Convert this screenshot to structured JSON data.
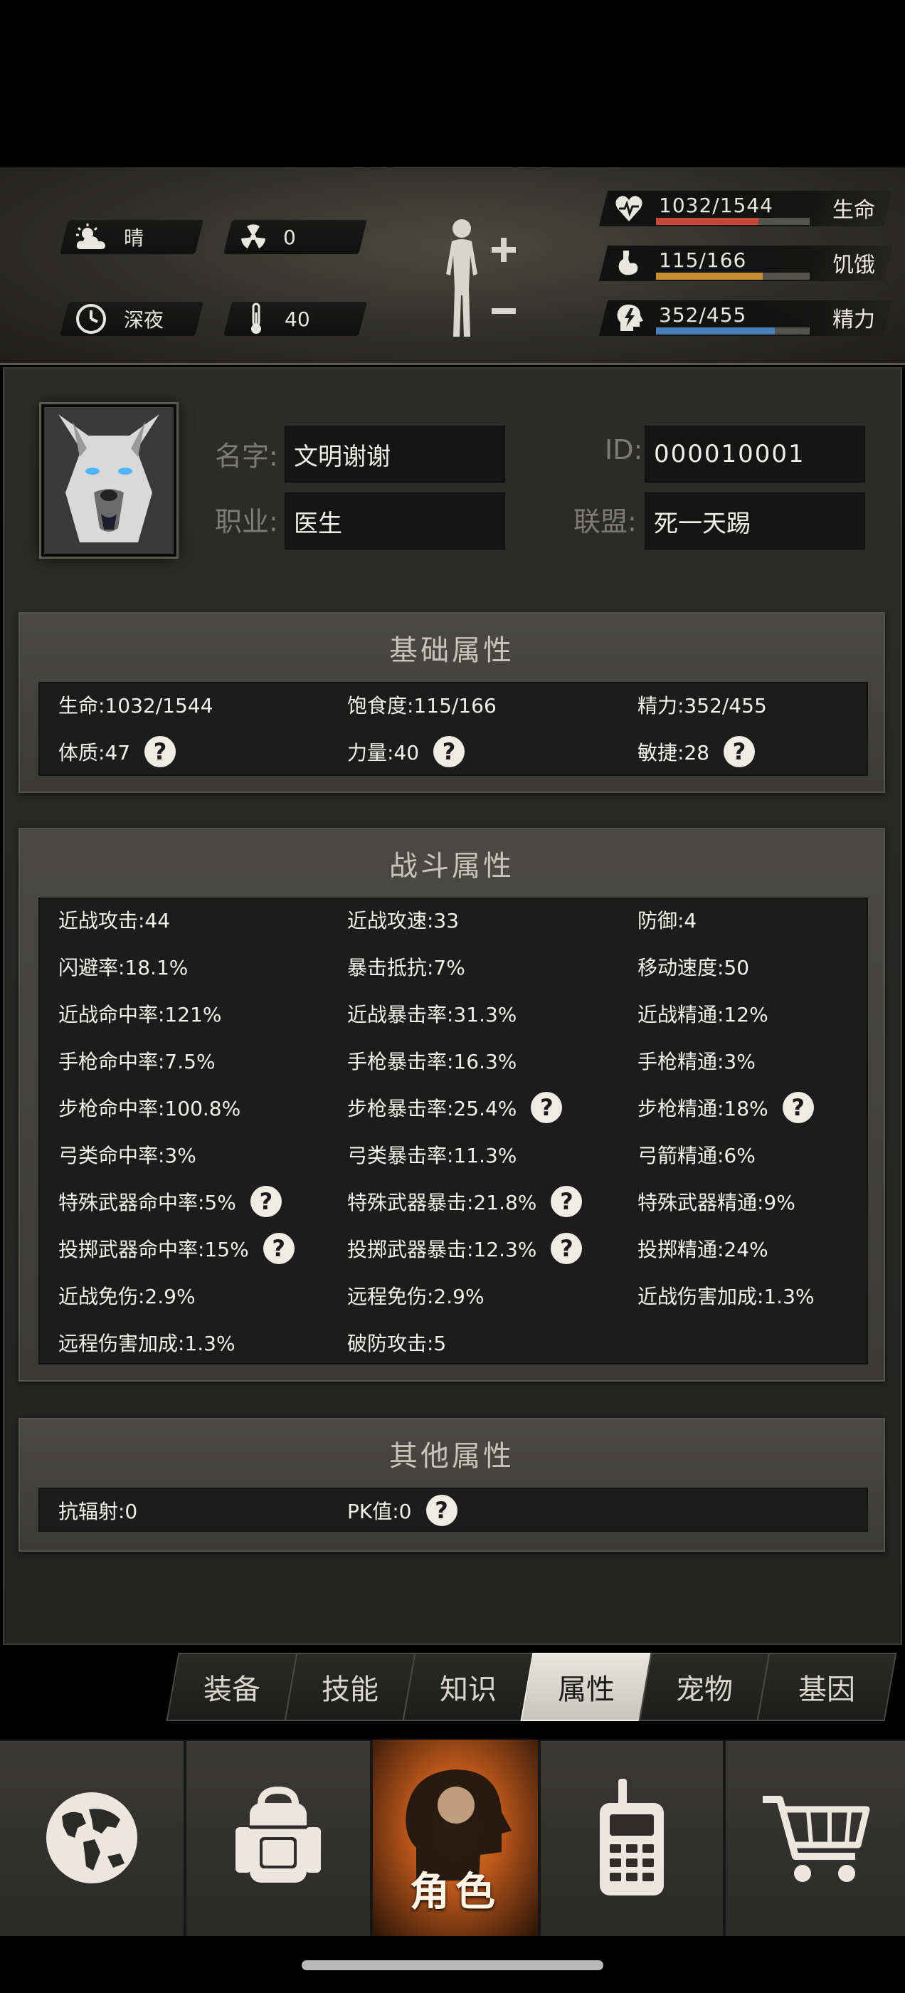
{
  "status": {
    "weather": "晴",
    "radiation": "0",
    "time_of_day": "深夜",
    "temperature": "40",
    "icons": {
      "weather": "partly-cloudy-icon",
      "radiation": "radiation-icon",
      "time": "clock-icon",
      "temperature": "thermometer-icon"
    }
  },
  "vitals": [
    {
      "value": "1032/1544",
      "label": "生命",
      "fraction": 0.668,
      "color": "#c4473b",
      "icon": "heart-icon"
    },
    {
      "value": "115/166",
      "label": "饥饿",
      "fraction": 0.693,
      "color": "#c98d36",
      "icon": "stomach-icon"
    },
    {
      "value": "352/455",
      "label": "精力",
      "fraction": 0.774,
      "color": "#4b7fba",
      "icon": "energy-head-icon"
    }
  ],
  "profile": {
    "name_label": "名字:",
    "name_value": "文明谢谢",
    "id_label": "ID:",
    "id_value": "000010001",
    "job_label": "职业:",
    "job_value": "医生",
    "alliance_label": "联盟:",
    "alliance_value": "死一天踢"
  },
  "basic": {
    "title": "基础属性",
    "rows": [
      [
        "生命:1032/1544",
        "饱食度:115/166",
        "精力:352/455"
      ],
      [
        "体质:47",
        "力量:40",
        "敏捷:28"
      ]
    ]
  },
  "combat": {
    "title": "战斗属性",
    "rows": [
      [
        "近战攻击:44",
        "近战攻速:33",
        "防御:4"
      ],
      [
        "闪避率:18.1%",
        "暴击抵抗:7%",
        "移动速度:50"
      ],
      [
        "近战命中率:121%",
        "近战暴击率:31.3%",
        "近战精通:12%"
      ],
      [
        "手枪命中率:7.5%",
        "手枪暴击率:16.3%",
        "手枪精通:3%"
      ],
      [
        "步枪命中率:100.8%",
        "步枪暴击率:25.4%",
        "步枪精通:18%"
      ],
      [
        "弓类命中率:3%",
        "弓类暴击率:11.3%",
        "弓箭精通:6%"
      ],
      [
        "特殊武器命中率:5%",
        "特殊武器暴击:21.8%",
        "特殊武器精通:9%"
      ],
      [
        "投掷武器命中率:15%",
        "投掷武器暴击:12.3%",
        "投掷精通:24%"
      ],
      [
        "近战免伤:2.9%",
        "远程免伤:2.9%",
        "近战伤害加成:1.3%"
      ],
      [
        "远程伤害加成:1.3%",
        "破防攻击:5",
        ""
      ]
    ]
  },
  "other": {
    "title": "其他属性",
    "rows": [
      [
        "抗辐射:0",
        "PK值:0"
      ]
    ]
  },
  "help_glyph": "?",
  "tabs": [
    "装备",
    "技能",
    "知识",
    "属性",
    "宠物",
    "基因"
  ],
  "active_tab": "属性",
  "nav": {
    "items": [
      "world-map-icon",
      "backpack-icon",
      "character-icon",
      "walkie-talkie-icon",
      "shopping-cart-icon"
    ],
    "active_label": "角色"
  }
}
